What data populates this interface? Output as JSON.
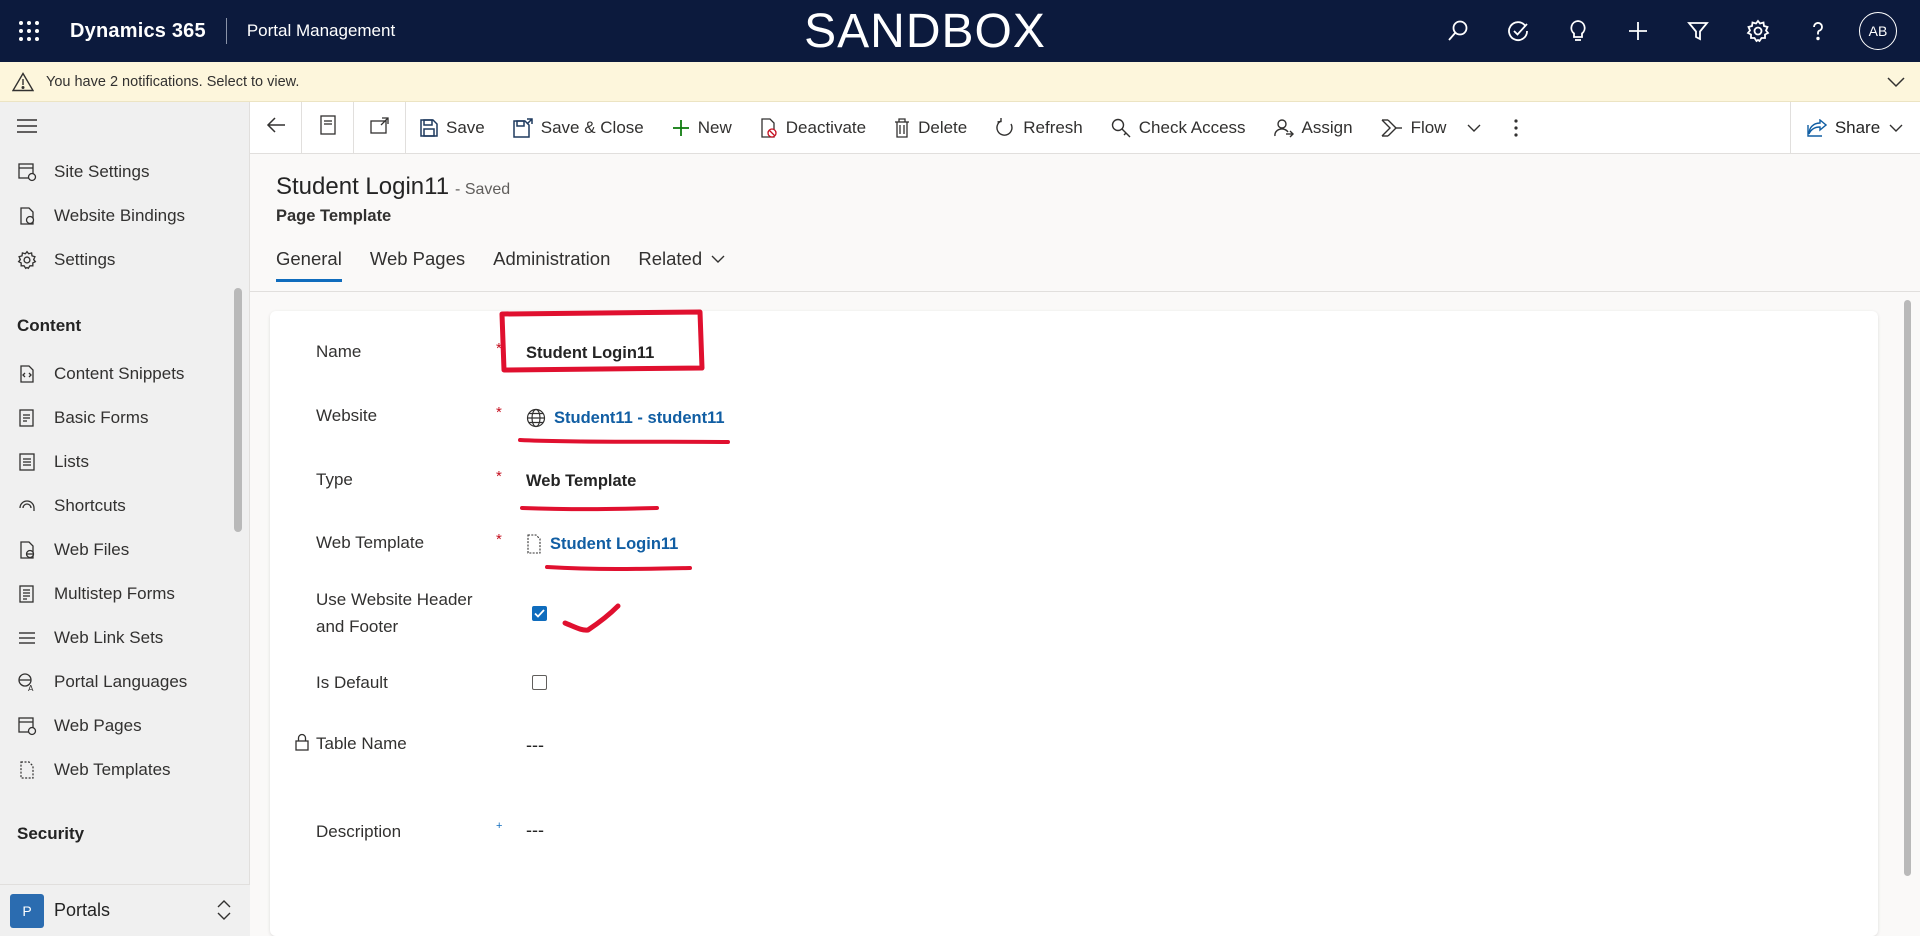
{
  "topbar": {
    "app_name": "Dynamics 365",
    "area_name": "Portal Management",
    "environment_banner": "SANDBOX",
    "icons": [
      "search-icon",
      "task-check-icon",
      "lightbulb-icon",
      "plus-icon",
      "filter-icon",
      "gear-icon",
      "help-icon"
    ],
    "avatar_initials": "AB"
  },
  "notification": {
    "text": "You have 2 notifications. Select to view."
  },
  "sidebar": {
    "items_top": [
      {
        "label": "Site Settings",
        "icon": "site-settings-icon"
      },
      {
        "label": "Website Bindings",
        "icon": "website-bindings-icon"
      },
      {
        "label": "Settings",
        "icon": "gear-icon"
      }
    ],
    "content_group": "Content",
    "content_items": [
      {
        "label": "Content Snippets"
      },
      {
        "label": "Basic Forms"
      },
      {
        "label": "Lists"
      },
      {
        "label": "Shortcuts"
      },
      {
        "label": "Web Files"
      },
      {
        "label": "Multistep Forms"
      },
      {
        "label": "Web Link Sets"
      },
      {
        "label": "Portal Languages"
      },
      {
        "label": "Web Pages"
      },
      {
        "label": "Web Templates"
      }
    ],
    "security_group": "Security",
    "area_badge": "P",
    "area_label": "Portals"
  },
  "commandbar": {
    "save": "Save",
    "save_close": "Save & Close",
    "new": "New",
    "deactivate": "Deactivate",
    "delete": "Delete",
    "refresh": "Refresh",
    "check_access": "Check Access",
    "assign": "Assign",
    "flow": "Flow",
    "share": "Share"
  },
  "record": {
    "title": "Student Login11",
    "status": "- Saved",
    "entity": "Page Template"
  },
  "tabs": [
    {
      "label": "General",
      "active": true
    },
    {
      "label": "Web Pages",
      "active": false
    },
    {
      "label": "Administration",
      "active": false
    },
    {
      "label": "Related",
      "active": false
    }
  ],
  "form": {
    "name_label": "Name",
    "name_value": "Student Login11",
    "website_label": "Website",
    "website_value": "Student11 - student11",
    "type_label": "Type",
    "type_value": "Web Template",
    "web_template_label": "Web Template",
    "web_template_value": "Student Login11",
    "use_header_footer_label_1": "Use Website Header",
    "use_header_footer_label_2": "and Footer",
    "use_header_footer_checked": true,
    "is_default_label": "Is Default",
    "is_default_checked": false,
    "table_name_label": "Table Name",
    "table_name_value": "---",
    "description_label": "Description",
    "description_value": "---",
    "required_marker": "*",
    "recommended_marker": "+"
  },
  "colors": {
    "nav_bg": "#0c1a3d",
    "notif_bg": "#fdf6dc",
    "accent": "#0f6cbd",
    "link": "#115ea3",
    "required": "#c50f1f",
    "annotation": "#e0102f"
  }
}
